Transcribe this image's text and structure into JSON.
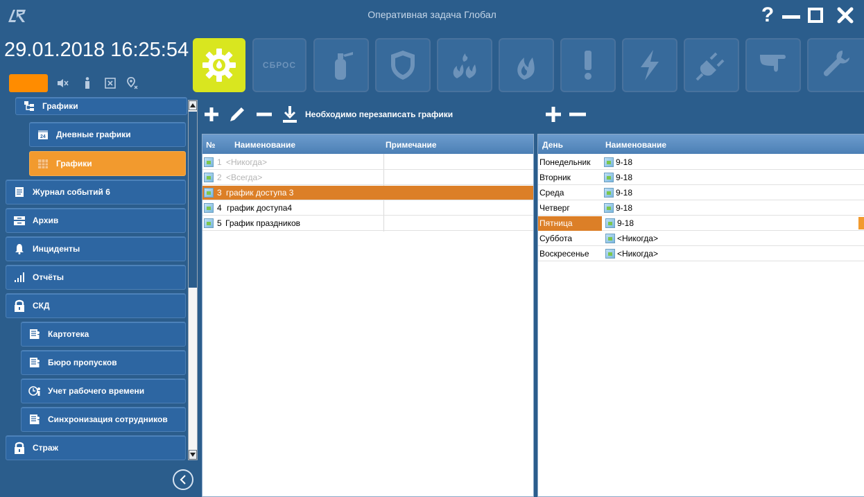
{
  "window": {
    "title": "Оперативная задача Глобал",
    "help": "?"
  },
  "header": {
    "datetime": "29.01.2018 16:25:54"
  },
  "toolbar": {
    "sbros": "СБРОС"
  },
  "nav": [
    {
      "label": "Графики",
      "icon": "schedule-tree-icon"
    },
    {
      "label": "Дневные графики",
      "icon": "calendar-icon"
    },
    {
      "label": "Графики",
      "icon": "calendar-grid-icon"
    },
    {
      "label": "Журнал событий 6",
      "icon": "journal-icon"
    },
    {
      "label": "Архив",
      "icon": "archive-icon"
    },
    {
      "label": "Инциденты",
      "icon": "bell-icon"
    },
    {
      "label": "Отчёты",
      "icon": "bar-chart-icon"
    },
    {
      "label": "СКД",
      "icon": "lock-icon"
    },
    {
      "label": "Картотека",
      "icon": "card-file-icon"
    },
    {
      "label": "Бюро пропусков",
      "icon": "card-file-icon"
    },
    {
      "label": "Учет рабочего времени",
      "icon": "clock-person-icon"
    },
    {
      "label": "Синхронизация сотрудников",
      "icon": "card-file-icon"
    },
    {
      "label": "Страж",
      "icon": "lock-icon"
    }
  ],
  "schedules_actions": {
    "notice": "Необходимо перезаписать графики"
  },
  "schedules_grid": {
    "columns": [
      "№",
      "Наименование",
      "Примечание"
    ],
    "rows": [
      {
        "num": "1",
        "name": "<Никогда>",
        "note": "",
        "state": "dim"
      },
      {
        "num": "2",
        "name": "<Всегда>",
        "note": "",
        "state": "dim"
      },
      {
        "num": "3",
        "name": "график доступа 3",
        "note": "",
        "state": "selected"
      },
      {
        "num": "4",
        "name": "график доступа4",
        "note": "",
        "state": "normal"
      },
      {
        "num": "5",
        "name": "График праздников",
        "note": "",
        "state": "normal"
      }
    ]
  },
  "days_grid": {
    "columns": [
      "День",
      "Наименование"
    ],
    "rows": [
      {
        "day": "Понедельник",
        "name": "9-18",
        "state": "normal"
      },
      {
        "day": "Вторник",
        "name": "9-18",
        "state": "normal"
      },
      {
        "day": "Среда",
        "name": "9-18",
        "state": "normal"
      },
      {
        "day": "Четверг",
        "name": "9-18",
        "state": "normal"
      },
      {
        "day": "Пятница",
        "name": "9-18",
        "state": "selected"
      },
      {
        "day": "Суббота",
        "name": "<Никогда>",
        "state": "normal"
      },
      {
        "day": "Воскресенье",
        "name": "<Никогда>",
        "state": "normal"
      }
    ]
  },
  "colors": {
    "background": "#2b5d8c",
    "accent_orange": "#f29a2e",
    "active_tool": "#d9e61f",
    "selection_row": "#dc7f27"
  }
}
